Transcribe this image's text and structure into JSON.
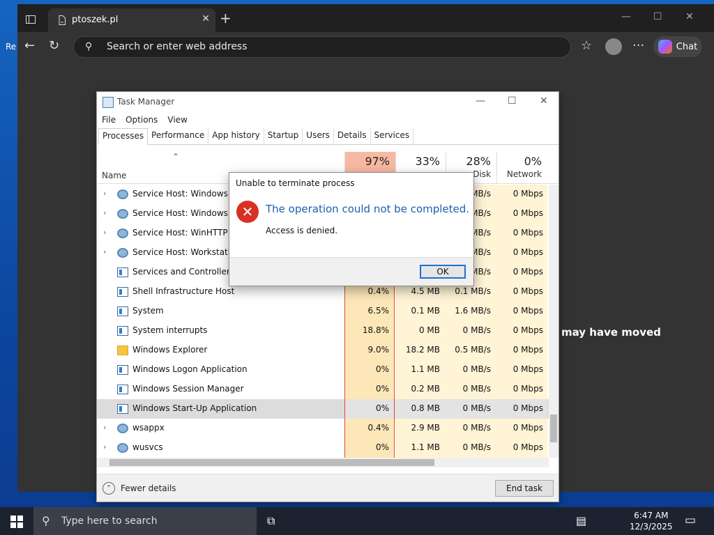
{
  "desktop": {
    "label": "Re"
  },
  "browser": {
    "tab_title": "ptoszek.pl",
    "new_tab": "+",
    "address_placeholder": "Search or enter web address",
    "chat_label": "Chat",
    "page_text": "may have moved"
  },
  "task_manager": {
    "title": "Task Manager",
    "menu": [
      "File",
      "Options",
      "View"
    ],
    "tabs": [
      "Processes",
      "Performance",
      "App history",
      "Startup",
      "Users",
      "Details",
      "Services"
    ],
    "active_tab": "Processes",
    "columns": {
      "name": "Name",
      "cpu_pct": "97%",
      "mem_pct": "33%",
      "disk_pct": "28%",
      "disk_label": "Disk",
      "net_pct": "0%",
      "net_label": "Network"
    },
    "rows": [
      {
        "name": "Service Host: Windows Pus",
        "icon": "gear-icon",
        "expandable": true,
        "cpu": "",
        "mem": "",
        "disk": "MB/s",
        "net": "0 Mbps"
      },
      {
        "name": "Service Host: Windows Up",
        "icon": "gear-icon",
        "expandable": true,
        "cpu": "",
        "mem": "",
        "disk": "MB/s",
        "net": "0 Mbps"
      },
      {
        "name": "Service Host: WinHTTP We",
        "icon": "gear-icon",
        "expandable": true,
        "cpu": "",
        "mem": "",
        "disk": "MB/s",
        "net": "0 Mbps"
      },
      {
        "name": "Service Host: Workstation",
        "icon": "gear-icon",
        "expandable": true,
        "cpu": "",
        "mem": "",
        "disk": "MB/s",
        "net": "0 Mbps"
      },
      {
        "name": "Services and Controller app",
        "icon": "window-icon",
        "expandable": false,
        "cpu": "",
        "mem": "",
        "disk": "MB/s",
        "net": "0 Mbps"
      },
      {
        "name": "Shell Infrastructure Host",
        "icon": "window-icon",
        "expandable": false,
        "cpu": "0.4%",
        "mem": "4.5 MB",
        "disk": "0.1 MB/s",
        "net": "0 Mbps"
      },
      {
        "name": "System",
        "icon": "window-icon",
        "expandable": false,
        "cpu": "6.5%",
        "mem": "0.1 MB",
        "disk": "1.6 MB/s",
        "net": "0 Mbps"
      },
      {
        "name": "System interrupts",
        "icon": "window-icon",
        "expandable": false,
        "cpu": "18.8%",
        "mem": "0 MB",
        "disk": "0 MB/s",
        "net": "0 Mbps"
      },
      {
        "name": "Windows Explorer",
        "icon": "folder-icon",
        "expandable": false,
        "cpu": "9.0%",
        "mem": "18.2 MB",
        "disk": "0.5 MB/s",
        "net": "0 Mbps"
      },
      {
        "name": "Windows Logon Application",
        "icon": "window-icon",
        "expandable": false,
        "cpu": "0%",
        "mem": "1.1 MB",
        "disk": "0 MB/s",
        "net": "0 Mbps"
      },
      {
        "name": "Windows Session Manager",
        "icon": "window-icon",
        "expandable": false,
        "cpu": "0%",
        "mem": "0.2 MB",
        "disk": "0 MB/s",
        "net": "0 Mbps"
      },
      {
        "name": "Windows Start-Up Application",
        "icon": "window-icon",
        "expandable": false,
        "cpu": "0%",
        "mem": "0.8 MB",
        "disk": "0 MB/s",
        "net": "0 Mbps",
        "selected": true
      },
      {
        "name": "wsappx",
        "icon": "gear-icon",
        "expandable": true,
        "cpu": "0.4%",
        "mem": "2.9 MB",
        "disk": "0 MB/s",
        "net": "0 Mbps"
      },
      {
        "name": "wusvcs",
        "icon": "gear-icon",
        "expandable": true,
        "cpu": "0%",
        "mem": "1.1 MB",
        "disk": "0 MB/s",
        "net": "0 Mbps"
      }
    ],
    "fewer_details": "Fewer details",
    "end_task": "End task"
  },
  "dialog": {
    "title": "Unable to terminate process",
    "message": "The operation could not be completed.",
    "detail": "Access is denied.",
    "ok": "OK"
  },
  "taskbar": {
    "search_placeholder": "Type here to search",
    "time": "6:47 AM",
    "date": "12/3/2025"
  }
}
